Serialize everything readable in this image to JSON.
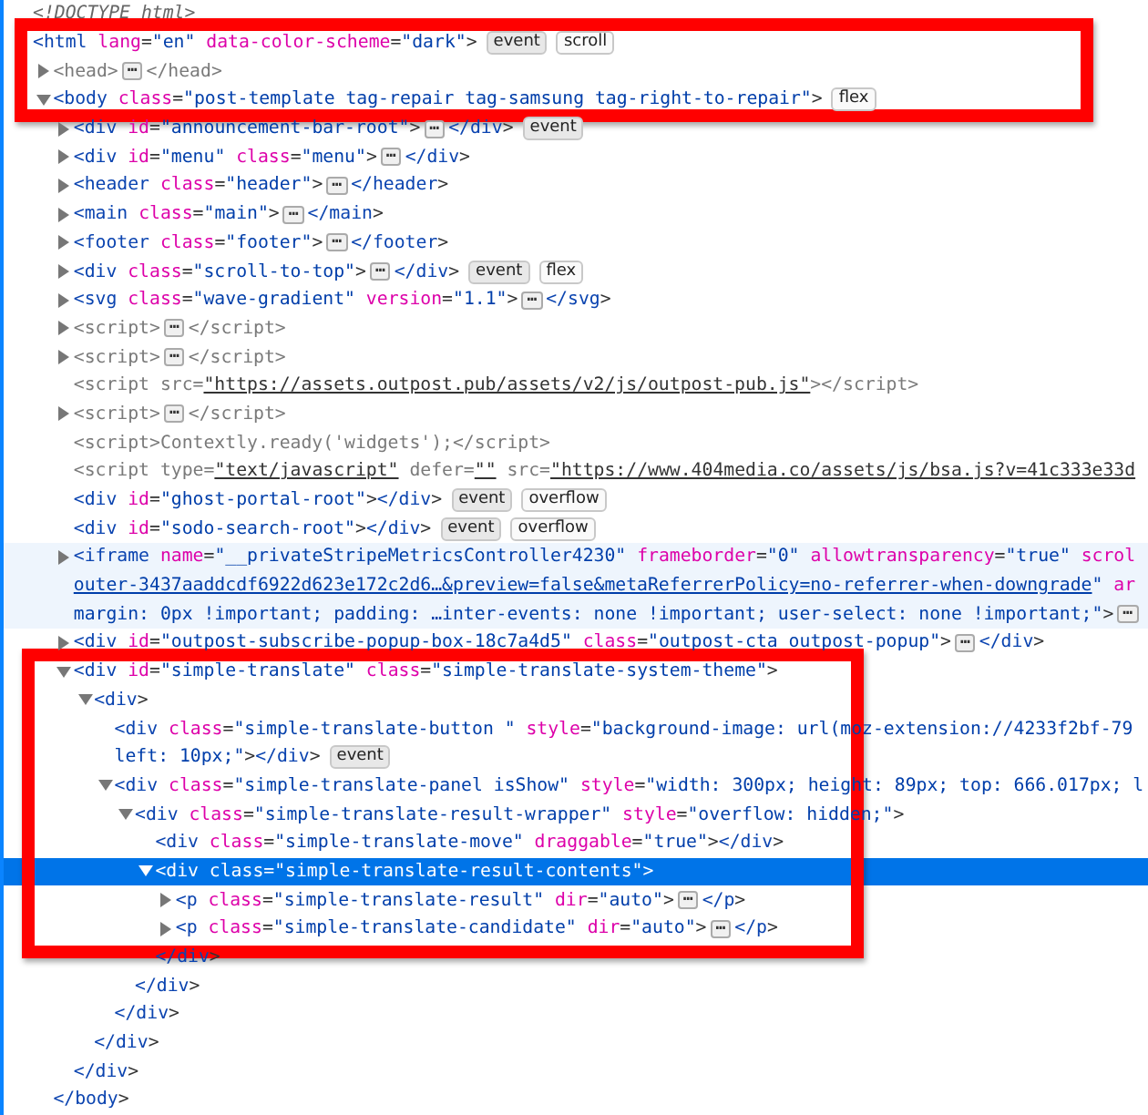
{
  "annotations": [
    {
      "kind": "red-frame"
    },
    {
      "kind": "red-frame"
    }
  ],
  "tree": [
    {
      "selected": false,
      "lines": [
        [
          {
            "kind": "doctype",
            "text": "<!DOCTYPE html>"
          }
        ]
      ]
    },
    {
      "selected": false,
      "lines": [
        [
          {
            "kind": "tag",
            "text": "<html"
          },
          {
            "kind": "attr",
            "text": " lang"
          },
          {
            "kind": "punct",
            "text": "="
          },
          {
            "kind": "val",
            "text": "\"en\""
          },
          {
            "kind": "attr",
            "text": " data-color-scheme"
          },
          {
            "kind": "punct",
            "text": "="
          },
          {
            "kind": "val",
            "text": "\"dark\""
          },
          {
            "kind": "punct",
            "text": ">"
          }
        ]
      ],
      "badges": [
        {
          "kind": "event",
          "label": "event"
        },
        {
          "kind": "layout",
          "label": "scroll"
        }
      ],
      "children": [
        {
          "expanded": false,
          "selected": false,
          "lines": [
            [
              {
                "kind": "dim",
                "text": "<head>"
              },
              {
                "kind": "more",
                "text": "⋯"
              },
              {
                "kind": "dim",
                "text": "</head>"
              }
            ]
          ]
        },
        {
          "expanded": true,
          "selected": false,
          "lines": [
            [
              {
                "kind": "tag",
                "text": "<body"
              },
              {
                "kind": "attr",
                "text": " class"
              },
              {
                "kind": "punct",
                "text": "="
              },
              {
                "kind": "val",
                "text": "\"post-template tag-repair tag-samsung tag-right-to-repair\""
              },
              {
                "kind": "punct",
                "text": ">"
              }
            ]
          ],
          "badges": [
            {
              "kind": "layout",
              "label": "flex"
            }
          ],
          "close": [
            {
              "kind": "tag",
              "text": "</body"
            },
            {
              "kind": "punct",
              "text": ">"
            }
          ],
          "children": [
            {
              "expanded": false,
              "selected": false,
              "lines": [
                [
                  {
                    "kind": "tag",
                    "text": "<div"
                  },
                  {
                    "kind": "attr",
                    "text": " id"
                  },
                  {
                    "kind": "punct",
                    "text": "="
                  },
                  {
                    "kind": "val",
                    "text": "\"announcement-bar-root\""
                  },
                  {
                    "kind": "punct",
                    "text": ">"
                  },
                  {
                    "kind": "more",
                    "text": "⋯"
                  },
                  {
                    "kind": "tag",
                    "text": "</div"
                  },
                  {
                    "kind": "punct",
                    "text": ">"
                  }
                ]
              ],
              "badges": [
                {
                  "kind": "event",
                  "label": "event"
                }
              ]
            },
            {
              "expanded": false,
              "selected": false,
              "lines": [
                [
                  {
                    "kind": "tag",
                    "text": "<div"
                  },
                  {
                    "kind": "attr",
                    "text": " id"
                  },
                  {
                    "kind": "punct",
                    "text": "="
                  },
                  {
                    "kind": "val",
                    "text": "\"menu\""
                  },
                  {
                    "kind": "attr",
                    "text": " class"
                  },
                  {
                    "kind": "punct",
                    "text": "="
                  },
                  {
                    "kind": "val",
                    "text": "\"menu\""
                  },
                  {
                    "kind": "punct",
                    "text": ">"
                  },
                  {
                    "kind": "more",
                    "text": "⋯"
                  },
                  {
                    "kind": "tag",
                    "text": "</div"
                  },
                  {
                    "kind": "punct",
                    "text": ">"
                  }
                ]
              ]
            },
            {
              "expanded": false,
              "selected": false,
              "lines": [
                [
                  {
                    "kind": "tag",
                    "text": "<header"
                  },
                  {
                    "kind": "attr",
                    "text": " class"
                  },
                  {
                    "kind": "punct",
                    "text": "="
                  },
                  {
                    "kind": "val",
                    "text": "\"header\""
                  },
                  {
                    "kind": "punct",
                    "text": ">"
                  },
                  {
                    "kind": "more",
                    "text": "⋯"
                  },
                  {
                    "kind": "tag",
                    "text": "</header"
                  },
                  {
                    "kind": "punct",
                    "text": ">"
                  }
                ]
              ]
            },
            {
              "expanded": false,
              "selected": false,
              "lines": [
                [
                  {
                    "kind": "tag",
                    "text": "<main"
                  },
                  {
                    "kind": "attr",
                    "text": " class"
                  },
                  {
                    "kind": "punct",
                    "text": "="
                  },
                  {
                    "kind": "val",
                    "text": "\"main\""
                  },
                  {
                    "kind": "punct",
                    "text": ">"
                  },
                  {
                    "kind": "more",
                    "text": "⋯"
                  },
                  {
                    "kind": "tag",
                    "text": "</main"
                  },
                  {
                    "kind": "punct",
                    "text": ">"
                  }
                ]
              ]
            },
            {
              "expanded": false,
              "selected": false,
              "lines": [
                [
                  {
                    "kind": "tag",
                    "text": "<footer"
                  },
                  {
                    "kind": "attr",
                    "text": " class"
                  },
                  {
                    "kind": "punct",
                    "text": "="
                  },
                  {
                    "kind": "val",
                    "text": "\"footer\""
                  },
                  {
                    "kind": "punct",
                    "text": ">"
                  },
                  {
                    "kind": "more",
                    "text": "⋯"
                  },
                  {
                    "kind": "tag",
                    "text": "</footer"
                  },
                  {
                    "kind": "punct",
                    "text": ">"
                  }
                ]
              ]
            },
            {
              "expanded": false,
              "selected": false,
              "lines": [
                [
                  {
                    "kind": "tag",
                    "text": "<div"
                  },
                  {
                    "kind": "attr",
                    "text": " class"
                  },
                  {
                    "kind": "punct",
                    "text": "="
                  },
                  {
                    "kind": "val",
                    "text": "\"scroll-to-top\""
                  },
                  {
                    "kind": "punct",
                    "text": ">"
                  },
                  {
                    "kind": "more",
                    "text": "⋯"
                  },
                  {
                    "kind": "tag",
                    "text": "</div"
                  },
                  {
                    "kind": "punct",
                    "text": ">"
                  }
                ]
              ],
              "badges": [
                {
                  "kind": "event",
                  "label": "event"
                },
                {
                  "kind": "layout",
                  "label": "flex"
                }
              ]
            },
            {
              "expanded": false,
              "selected": false,
              "lines": [
                [
                  {
                    "kind": "tag",
                    "text": "<svg"
                  },
                  {
                    "kind": "attr",
                    "text": " class"
                  },
                  {
                    "kind": "punct",
                    "text": "="
                  },
                  {
                    "kind": "val",
                    "text": "\"wave-gradient\""
                  },
                  {
                    "kind": "attr",
                    "text": " version"
                  },
                  {
                    "kind": "punct",
                    "text": "="
                  },
                  {
                    "kind": "val",
                    "text": "\"1.1\""
                  },
                  {
                    "kind": "punct",
                    "text": ">"
                  },
                  {
                    "kind": "more",
                    "text": "⋯"
                  },
                  {
                    "kind": "tag",
                    "text": "</svg"
                  },
                  {
                    "kind": "punct",
                    "text": ">"
                  }
                ]
              ]
            },
            {
              "expanded": false,
              "selected": false,
              "lines": [
                [
                  {
                    "kind": "dim",
                    "text": "<script>"
                  },
                  {
                    "kind": "more",
                    "text": "⋯"
                  },
                  {
                    "kind": "dim",
                    "text": "</script>"
                  }
                ]
              ]
            },
            {
              "expanded": false,
              "selected": false,
              "lines": [
                [
                  {
                    "kind": "dim",
                    "text": "<script>"
                  },
                  {
                    "kind": "more",
                    "text": "⋯"
                  },
                  {
                    "kind": "dim",
                    "text": "</script>"
                  }
                ]
              ]
            },
            {
              "selected": false,
              "lines": [
                [
                  {
                    "kind": "dim",
                    "text": "<script src="
                  },
                  {
                    "kind": "url",
                    "text": "\"https://assets.outpost.pub/assets/v2/js/outpost-pub.js\""
                  },
                  {
                    "kind": "dim",
                    "text": "></script>"
                  }
                ]
              ]
            },
            {
              "expanded": false,
              "selected": false,
              "lines": [
                [
                  {
                    "kind": "dim",
                    "text": "<script>"
                  },
                  {
                    "kind": "more",
                    "text": "⋯"
                  },
                  {
                    "kind": "dim",
                    "text": "</script>"
                  }
                ]
              ]
            },
            {
              "selected": false,
              "lines": [
                [
                  {
                    "kind": "dim",
                    "text": "<script>"
                  },
                  {
                    "kind": "plain",
                    "text": "Contextly.ready('widgets');"
                  },
                  {
                    "kind": "dim",
                    "text": "</script>"
                  }
                ]
              ]
            },
            {
              "selected": false,
              "lines": [
                [
                  {
                    "kind": "dim",
                    "text": "<script type="
                  },
                  {
                    "kind": "url",
                    "text": "\"text/javascript\""
                  },
                  {
                    "kind": "dim",
                    "text": " defer="
                  },
                  {
                    "kind": "url",
                    "text": "\"\""
                  },
                  {
                    "kind": "dim",
                    "text": " src="
                  },
                  {
                    "kind": "url",
                    "text": "\"https://www.404media.co/assets/js/bsa.js?v=41c333e33d"
                  }
                ]
              ]
            },
            {
              "selected": false,
              "lines": [
                [
                  {
                    "kind": "tag",
                    "text": "<div"
                  },
                  {
                    "kind": "attr",
                    "text": " id"
                  },
                  {
                    "kind": "punct",
                    "text": "="
                  },
                  {
                    "kind": "val",
                    "text": "\"ghost-portal-root\""
                  },
                  {
                    "kind": "punct",
                    "text": ">"
                  },
                  {
                    "kind": "tag",
                    "text": "</div"
                  },
                  {
                    "kind": "punct",
                    "text": ">"
                  }
                ]
              ],
              "badges": [
                {
                  "kind": "event",
                  "label": "event"
                },
                {
                  "kind": "layout",
                  "label": "overflow"
                }
              ]
            },
            {
              "selected": false,
              "lines": [
                [
                  {
                    "kind": "tag",
                    "text": "<div"
                  },
                  {
                    "kind": "attr",
                    "text": " id"
                  },
                  {
                    "kind": "punct",
                    "text": "="
                  },
                  {
                    "kind": "val",
                    "text": "\"sodo-search-root\""
                  },
                  {
                    "kind": "punct",
                    "text": ">"
                  },
                  {
                    "kind": "tag",
                    "text": "</div"
                  },
                  {
                    "kind": "punct",
                    "text": ">"
                  }
                ]
              ],
              "badges": [
                {
                  "kind": "event",
                  "label": "event"
                },
                {
                  "kind": "layout",
                  "label": "overflow"
                }
              ]
            },
            {
              "expanded": false,
              "selected": false,
              "hovered": true,
              "lines": [
                [
                  {
                    "kind": "tag",
                    "text": "<iframe"
                  },
                  {
                    "kind": "attr",
                    "text": " name"
                  },
                  {
                    "kind": "punct",
                    "text": "="
                  },
                  {
                    "kind": "val",
                    "text": "\"__privateStripeMetricsController4230\""
                  },
                  {
                    "kind": "attr",
                    "text": " frameborder"
                  },
                  {
                    "kind": "punct",
                    "text": "="
                  },
                  {
                    "kind": "val",
                    "text": "\"0\""
                  },
                  {
                    "kind": "attr",
                    "text": " allowtransparency"
                  },
                  {
                    "kind": "punct",
                    "text": "="
                  },
                  {
                    "kind": "val",
                    "text": "\"true\""
                  },
                  {
                    "kind": "attr",
                    "text": " scrol"
                  }
                ],
                [
                  {
                    "kind": "link",
                    "text": "outer-3437aaddcdf6922d623e172c2d6…&preview=false&metaReferrerPolicy=no-referrer-when-downgrade"
                  },
                  {
                    "kind": "val",
                    "text": "\""
                  },
                  {
                    "kind": "attr",
                    "text": " ar"
                  }
                ],
                [
                  {
                    "kind": "val",
                    "text": "margin: 0px !important; padding: …inter-events: none !important; user-select: none !important;\""
                  },
                  {
                    "kind": "punct",
                    "text": ">"
                  },
                  {
                    "kind": "more",
                    "text": "⋯"
                  }
                ]
              ]
            },
            {
              "expanded": false,
              "selected": false,
              "lines": [
                [
                  {
                    "kind": "tag",
                    "text": "<div"
                  },
                  {
                    "kind": "attr",
                    "text": " id"
                  },
                  {
                    "kind": "punct",
                    "text": "="
                  },
                  {
                    "kind": "val",
                    "text": "\"outpost-subscribe-popup-box-18c7a4d5\""
                  },
                  {
                    "kind": "attr",
                    "text": " class"
                  },
                  {
                    "kind": "punct",
                    "text": "="
                  },
                  {
                    "kind": "val",
                    "text": "\"outpost-cta outpost-popup\""
                  },
                  {
                    "kind": "punct",
                    "text": ">"
                  },
                  {
                    "kind": "more",
                    "text": "⋯"
                  },
                  {
                    "kind": "tag",
                    "text": "</div"
                  },
                  {
                    "kind": "punct",
                    "text": ">"
                  }
                ]
              ]
            },
            {
              "expanded": true,
              "selected": false,
              "lines": [
                [
                  {
                    "kind": "tag",
                    "text": "<div"
                  },
                  {
                    "kind": "attr",
                    "text": " id"
                  },
                  {
                    "kind": "punct",
                    "text": "="
                  },
                  {
                    "kind": "val",
                    "text": "\"simple-translate\""
                  },
                  {
                    "kind": "attr",
                    "text": " class"
                  },
                  {
                    "kind": "punct",
                    "text": "="
                  },
                  {
                    "kind": "val",
                    "text": "\"simple-translate-system-theme\""
                  },
                  {
                    "kind": "punct",
                    "text": ">"
                  }
                ]
              ],
              "close": [
                {
                  "kind": "tag",
                  "text": "</div"
                },
                {
                  "kind": "punct",
                  "text": ">"
                }
              ],
              "children": [
                {
                  "expanded": true,
                  "selected": false,
                  "lines": [
                    [
                      {
                        "kind": "tag",
                        "text": "<div"
                      },
                      {
                        "kind": "punct",
                        "text": ">"
                      }
                    ]
                  ],
                  "close": [
                    {
                      "kind": "tag",
                      "text": "</div"
                    },
                    {
                      "kind": "punct",
                      "text": ">"
                    }
                  ],
                  "children": [
                    {
                      "selected": false,
                      "lines": [
                        [
                          {
                            "kind": "tag",
                            "text": "<div"
                          },
                          {
                            "kind": "attr",
                            "text": " class"
                          },
                          {
                            "kind": "punct",
                            "text": "="
                          },
                          {
                            "kind": "val",
                            "text": "\"simple-translate-button \""
                          },
                          {
                            "kind": "attr",
                            "text": " style"
                          },
                          {
                            "kind": "punct",
                            "text": "="
                          },
                          {
                            "kind": "val",
                            "text": "\"background-image: url(moz-extension://4233f2bf-79"
                          }
                        ],
                        [
                          {
                            "kind": "val",
                            "text": "left: 10px;\""
                          },
                          {
                            "kind": "punct",
                            "text": ">"
                          },
                          {
                            "kind": "tag",
                            "text": "</div"
                          },
                          {
                            "kind": "punct",
                            "text": ">"
                          }
                        ]
                      ],
                      "badges": [
                        {
                          "kind": "event",
                          "label": "event"
                        }
                      ]
                    },
                    {
                      "expanded": true,
                      "selected": false,
                      "lines": [
                        [
                          {
                            "kind": "tag",
                            "text": "<div"
                          },
                          {
                            "kind": "attr",
                            "text": " class"
                          },
                          {
                            "kind": "punct",
                            "text": "="
                          },
                          {
                            "kind": "val",
                            "text": "\"simple-translate-panel isShow\""
                          },
                          {
                            "kind": "attr",
                            "text": " style"
                          },
                          {
                            "kind": "punct",
                            "text": "="
                          },
                          {
                            "kind": "val",
                            "text": "\"width: 300px; height: 89px; top: 666.017px; l"
                          }
                        ]
                      ],
                      "close": [
                        {
                          "kind": "tag",
                          "text": "</div"
                        },
                        {
                          "kind": "punct",
                          "text": ">"
                        }
                      ],
                      "children": [
                        {
                          "expanded": true,
                          "selected": false,
                          "lines": [
                            [
                              {
                                "kind": "tag",
                                "text": "<div"
                              },
                              {
                                "kind": "attr",
                                "text": " class"
                              },
                              {
                                "kind": "punct",
                                "text": "="
                              },
                              {
                                "kind": "val",
                                "text": "\"simple-translate-result-wrapper\""
                              },
                              {
                                "kind": "attr",
                                "text": " style"
                              },
                              {
                                "kind": "punct",
                                "text": "="
                              },
                              {
                                "kind": "val",
                                "text": "\"overflow: hidden;\""
                              },
                              {
                                "kind": "punct",
                                "text": ">"
                              }
                            ]
                          ],
                          "close": [
                            {
                              "kind": "tag",
                              "text": "</div"
                            },
                            {
                              "kind": "punct",
                              "text": ">"
                            }
                          ],
                          "children": [
                            {
                              "selected": false,
                              "lines": [
                                [
                                  {
                                    "kind": "tag",
                                    "text": "<div"
                                  },
                                  {
                                    "kind": "attr",
                                    "text": " class"
                                  },
                                  {
                                    "kind": "punct",
                                    "text": "="
                                  },
                                  {
                                    "kind": "val",
                                    "text": "\"simple-translate-move\""
                                  },
                                  {
                                    "kind": "attr",
                                    "text": " draggable"
                                  },
                                  {
                                    "kind": "punct",
                                    "text": "="
                                  },
                                  {
                                    "kind": "val",
                                    "text": "\"true\""
                                  },
                                  {
                                    "kind": "punct",
                                    "text": ">"
                                  },
                                  {
                                    "kind": "tag",
                                    "text": "</div"
                                  },
                                  {
                                    "kind": "punct",
                                    "text": ">"
                                  }
                                ]
                              ]
                            },
                            {
                              "expanded": true,
                              "selected": true,
                              "lines": [
                                [
                                  {
                                    "kind": "tag",
                                    "text": "<div"
                                  },
                                  {
                                    "kind": "attr",
                                    "text": " class"
                                  },
                                  {
                                    "kind": "punct",
                                    "text": "="
                                  },
                                  {
                                    "kind": "val",
                                    "text": "\"simple-translate-result-contents\""
                                  },
                                  {
                                    "kind": "punct",
                                    "text": ">"
                                  }
                                ]
                              ],
                              "close": [
                                {
                                  "kind": "tag",
                                  "text": "</div"
                                },
                                {
                                  "kind": "punct",
                                  "text": ">"
                                }
                              ],
                              "children": [
                                {
                                  "expanded": false,
                                  "selected": false,
                                  "lines": [
                                    [
                                      {
                                        "kind": "tag",
                                        "text": "<p"
                                      },
                                      {
                                        "kind": "attr",
                                        "text": " class"
                                      },
                                      {
                                        "kind": "punct",
                                        "text": "="
                                      },
                                      {
                                        "kind": "val",
                                        "text": "\"simple-translate-result\""
                                      },
                                      {
                                        "kind": "attr",
                                        "text": " dir"
                                      },
                                      {
                                        "kind": "punct",
                                        "text": "="
                                      },
                                      {
                                        "kind": "val",
                                        "text": "\"auto\""
                                      },
                                      {
                                        "kind": "punct",
                                        "text": ">"
                                      },
                                      {
                                        "kind": "more",
                                        "text": "⋯"
                                      },
                                      {
                                        "kind": "tag",
                                        "text": "</p"
                                      },
                                      {
                                        "kind": "punct",
                                        "text": ">"
                                      }
                                    ]
                                  ]
                                },
                                {
                                  "expanded": false,
                                  "selected": false,
                                  "lines": [
                                    [
                                      {
                                        "kind": "tag",
                                        "text": "<p"
                                      },
                                      {
                                        "kind": "attr",
                                        "text": " class"
                                      },
                                      {
                                        "kind": "punct",
                                        "text": "="
                                      },
                                      {
                                        "kind": "val",
                                        "text": "\"simple-translate-candidate\""
                                      },
                                      {
                                        "kind": "attr",
                                        "text": " dir"
                                      },
                                      {
                                        "kind": "punct",
                                        "text": "="
                                      },
                                      {
                                        "kind": "val",
                                        "text": "\"auto\""
                                      },
                                      {
                                        "kind": "punct",
                                        "text": ">"
                                      },
                                      {
                                        "kind": "more",
                                        "text": "⋯"
                                      },
                                      {
                                        "kind": "tag",
                                        "text": "</p"
                                      },
                                      {
                                        "kind": "punct",
                                        "text": ">"
                                      }
                                    ]
                                  ]
                                }
                              ]
                            }
                          ]
                        }
                      ]
                    }
                  ]
                }
              ]
            }
          ]
        }
      ]
    }
  ]
}
